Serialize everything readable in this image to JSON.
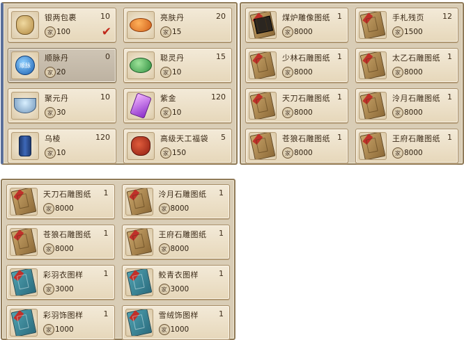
{
  "panel_a": [
    {
      "name": "银两包裹",
      "qty": "10",
      "coin": "家",
      "price": "100",
      "icon": "silver-bag-icon",
      "checked": true
    },
    {
      "name": "亮肤丹",
      "qty": "20",
      "coin": "家",
      "price": "15",
      "icon": "orange-pill-icon"
    },
    {
      "name": "顺脉丹",
      "qty": "0",
      "coin": "家",
      "price": "20",
      "icon": "blue-pill-icon",
      "selected": true,
      "pill_label": "顺脉"
    },
    {
      "name": "聪灵丹",
      "qty": "15",
      "coin": "家",
      "price": "10",
      "icon": "green-pill-icon"
    },
    {
      "name": "聚元丹",
      "qty": "10",
      "coin": "家",
      "price": "30",
      "icon": "gem-bowl-icon"
    },
    {
      "name": "紫金",
      "qty": "120",
      "coin": "家",
      "price": "10",
      "icon": "purple-crystal-icon"
    },
    {
      "name": "乌棱",
      "qty": "120",
      "coin": "家",
      "price": "10",
      "icon": "thread-spool-icon"
    },
    {
      "name": "高级天工福袋",
      "qty": "5",
      "coin": "家",
      "price": "150",
      "icon": "lucky-bag-icon"
    }
  ],
  "panel_b": [
    {
      "name": "煤炉雕像图纸",
      "qty": "1",
      "coin": "家",
      "price": "8000",
      "icon": "blueprint-dark-icon"
    },
    {
      "name": "手札残页",
      "qty": "12",
      "coin": "家",
      "price": "1500",
      "icon": "blueprint-icon"
    },
    {
      "name": "少林石雕图纸",
      "qty": "1",
      "coin": "家",
      "price": "8000",
      "icon": "blueprint-icon"
    },
    {
      "name": "太乙石雕图纸",
      "qty": "1",
      "coin": "家",
      "price": "8000",
      "icon": "blueprint-icon"
    },
    {
      "name": "天刀石雕图纸",
      "qty": "1",
      "coin": "家",
      "price": "8000",
      "icon": "blueprint-icon"
    },
    {
      "name": "泠月石雕图纸",
      "qty": "1",
      "coin": "家",
      "price": "8000",
      "icon": "blueprint-icon"
    },
    {
      "name": "苍狼石雕图纸",
      "qty": "1",
      "coin": "家",
      "price": "8000",
      "icon": "blueprint-icon"
    },
    {
      "name": "王府石雕图纸",
      "qty": "1",
      "coin": "家",
      "price": "8000",
      "icon": "blueprint-icon"
    }
  ],
  "panel_c": [
    {
      "name": "天刀石雕图纸",
      "qty": "1",
      "coin": "家",
      "price": "8000",
      "icon": "blueprint-icon"
    },
    {
      "name": "泠月石雕图纸",
      "qty": "1",
      "coin": "家",
      "price": "8000",
      "icon": "blueprint-icon"
    },
    {
      "name": "苍狼石雕图纸",
      "qty": "1",
      "coin": "家",
      "price": "8000",
      "icon": "blueprint-icon"
    },
    {
      "name": "王府石雕图纸",
      "qty": "1",
      "coin": "家",
      "price": "8000",
      "icon": "blueprint-icon"
    },
    {
      "name": "彩羽衣图样",
      "qty": "1",
      "coin": "家",
      "price": "3000",
      "icon": "pattern-book-icon"
    },
    {
      "name": "鲛青衣图样",
      "qty": "1",
      "coin": "家",
      "price": "3000",
      "icon": "pattern-book-icon"
    },
    {
      "name": "彩羽饰图样",
      "qty": "1",
      "coin": "家",
      "price": "1000",
      "icon": "pattern-book-icon"
    },
    {
      "name": "雪绒饰图样",
      "qty": "1",
      "coin": "家",
      "price": "1000",
      "icon": "pattern-book-icon"
    }
  ]
}
